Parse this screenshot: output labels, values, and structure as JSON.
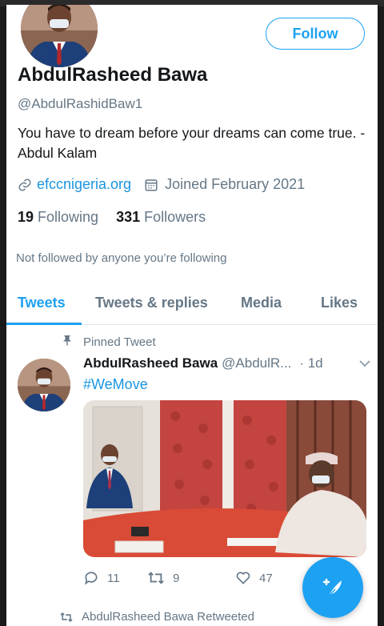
{
  "profile": {
    "display_name": "AbdulRasheed Bawa",
    "handle": "@AbdulRashidBaw1",
    "bio": "You have to dream before your dreams can come true.  - Abdul Kalam",
    "website": "efccnigeria.org",
    "joined": "Joined February 2021",
    "following_count": "19",
    "following_label": "Following",
    "followers_count": "331",
    "followers_label": "Followers",
    "follow_button": "Follow",
    "not_followed_text": "Not followed by anyone you’re following"
  },
  "tabs": [
    {
      "label": "Tweets",
      "active": true
    },
    {
      "label": "Tweets & replies",
      "active": false
    },
    {
      "label": "Media",
      "active": false
    },
    {
      "label": "Likes",
      "active": false
    }
  ],
  "pinned_tweet": {
    "pinned_label": "Pinned Tweet",
    "author_name": "AbdulRasheed Bawa",
    "author_handle": "@AbdulR...",
    "time": "· 1d",
    "text": "#WeMove",
    "reply_count": "11",
    "retweet_count": "9",
    "like_count": "47"
  },
  "next_tweet": {
    "retweet_label": "AbdulRasheed Bawa Retweeted"
  },
  "colors": {
    "accent": "#1da1f2",
    "link": "#1b95e0",
    "muted": "#657786"
  }
}
